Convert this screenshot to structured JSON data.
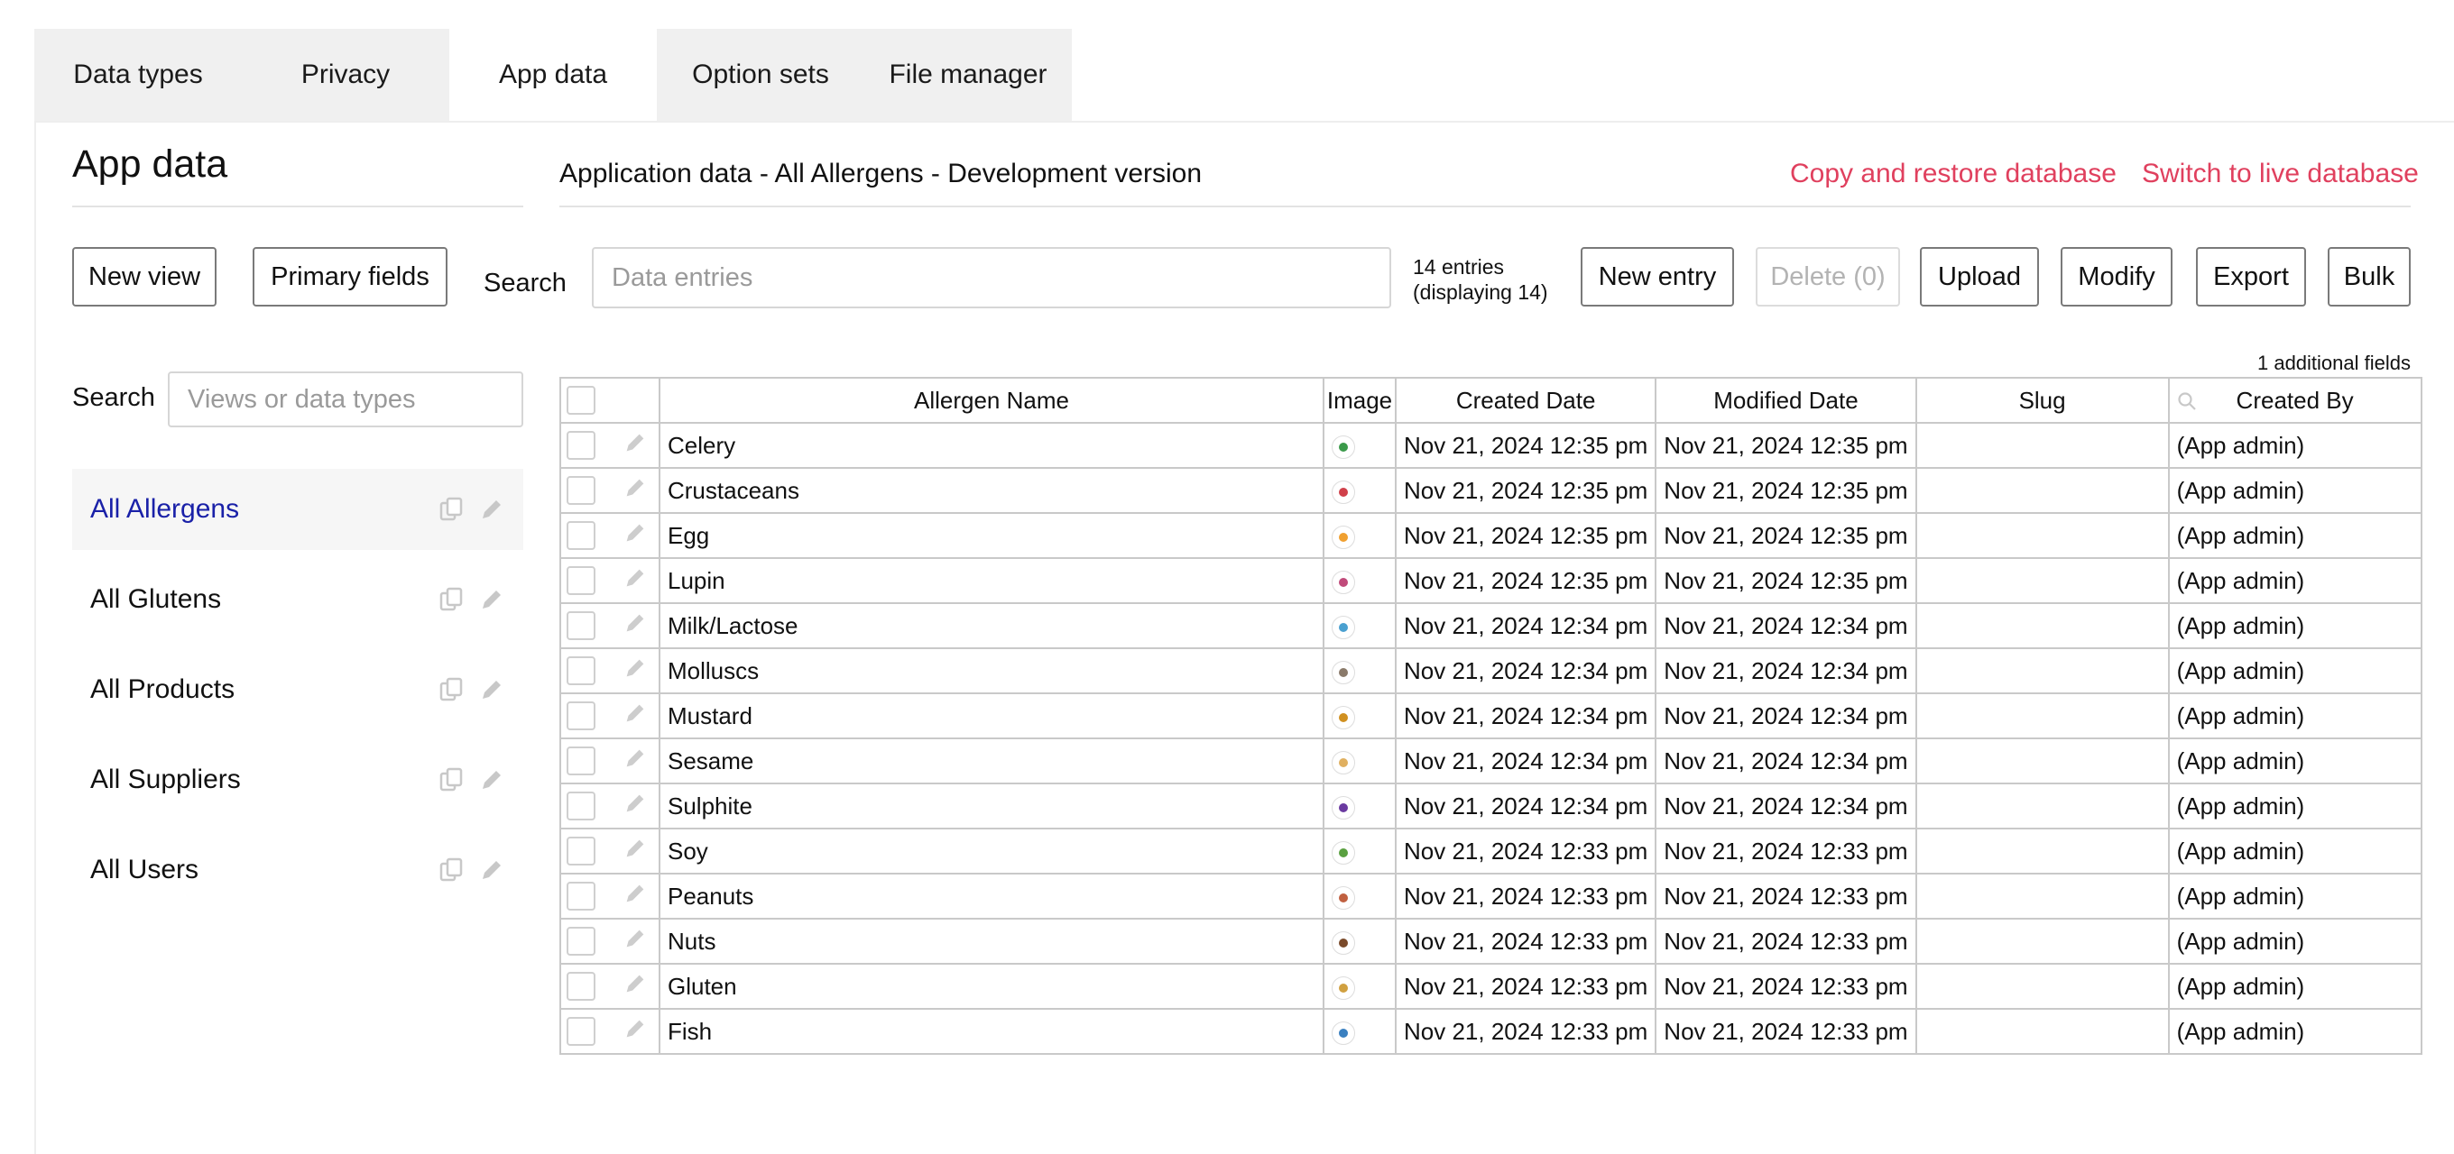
{
  "tabs": [
    {
      "label": "Data types",
      "active": false
    },
    {
      "label": "Privacy",
      "active": false
    },
    {
      "label": "App data",
      "active": true
    },
    {
      "label": "Option sets",
      "active": false
    },
    {
      "label": "File manager",
      "active": false
    }
  ],
  "left": {
    "title": "App data",
    "new_view": "New view",
    "primary_fields": "Primary fields",
    "search_label": "Search",
    "search_placeholder": "Views or data types",
    "views": [
      {
        "label": "All Allergens",
        "active": true
      },
      {
        "label": "All Glutens",
        "active": false
      },
      {
        "label": "All Products",
        "active": false
      },
      {
        "label": "All Suppliers",
        "active": false
      },
      {
        "label": "All Users",
        "active": false
      }
    ]
  },
  "main": {
    "title": "Application data - All Allergens - Development version",
    "copy_restore": "Copy and restore database",
    "switch_live": "Switch to live database",
    "search_label": "Search",
    "search_placeholder": "Data entries",
    "entries_line1": "14 entries",
    "entries_line2": "(displaying 14)",
    "buttons": {
      "new_entry": "New entry",
      "delete": "Delete (0)",
      "upload": "Upload",
      "modify": "Modify",
      "export": "Export",
      "bulk": "Bulk"
    },
    "additional_fields": "1 additional fields",
    "columns": [
      "Allergen Name",
      "Image",
      "Created Date",
      "Modified Date",
      "Slug",
      "Created By"
    ],
    "rows": [
      {
        "name": "Celery",
        "color": "#3b9a4a",
        "created": "Nov 21, 2024 12:35 pm",
        "modified": "Nov 21, 2024 12:35 pm",
        "slug": "",
        "by": "(App admin)"
      },
      {
        "name": "Crustaceans",
        "color": "#d0404a",
        "created": "Nov 21, 2024 12:35 pm",
        "modified": "Nov 21, 2024 12:35 pm",
        "slug": "",
        "by": "(App admin)"
      },
      {
        "name": "Egg",
        "color": "#f0a030",
        "created": "Nov 21, 2024 12:35 pm",
        "modified": "Nov 21, 2024 12:35 pm",
        "slug": "",
        "by": "(App admin)"
      },
      {
        "name": "Lupin",
        "color": "#c04a7a",
        "created": "Nov 21, 2024 12:35 pm",
        "modified": "Nov 21, 2024 12:35 pm",
        "slug": "",
        "by": "(App admin)"
      },
      {
        "name": "Milk/Lactose",
        "color": "#4aa0d0",
        "created": "Nov 21, 2024 12:34 pm",
        "modified": "Nov 21, 2024 12:34 pm",
        "slug": "",
        "by": "(App admin)"
      },
      {
        "name": "Molluscs",
        "color": "#8a7a6a",
        "created": "Nov 21, 2024 12:34 pm",
        "modified": "Nov 21, 2024 12:34 pm",
        "slug": "",
        "by": "(App admin)"
      },
      {
        "name": "Mustard",
        "color": "#d09020",
        "created": "Nov 21, 2024 12:34 pm",
        "modified": "Nov 21, 2024 12:34 pm",
        "slug": "",
        "by": "(App admin)"
      },
      {
        "name": "Sesame",
        "color": "#e0b060",
        "created": "Nov 21, 2024 12:34 pm",
        "modified": "Nov 21, 2024 12:34 pm",
        "slug": "",
        "by": "(App admin)"
      },
      {
        "name": "Sulphite",
        "color": "#6a3aa0",
        "created": "Nov 21, 2024 12:34 pm",
        "modified": "Nov 21, 2024 12:34 pm",
        "slug": "",
        "by": "(App admin)"
      },
      {
        "name": "Soy",
        "color": "#5aa040",
        "created": "Nov 21, 2024 12:33 pm",
        "modified": "Nov 21, 2024 12:33 pm",
        "slug": "",
        "by": "(App admin)"
      },
      {
        "name": "Peanuts",
        "color": "#c06040",
        "created": "Nov 21, 2024 12:33 pm",
        "modified": "Nov 21, 2024 12:33 pm",
        "slug": "",
        "by": "(App admin)"
      },
      {
        "name": "Nuts",
        "color": "#7a4a2a",
        "created": "Nov 21, 2024 12:33 pm",
        "modified": "Nov 21, 2024 12:33 pm",
        "slug": "",
        "by": "(App admin)"
      },
      {
        "name": "Gluten",
        "color": "#d0a040",
        "created": "Nov 21, 2024 12:33 pm",
        "modified": "Nov 21, 2024 12:33 pm",
        "slug": "",
        "by": "(App admin)"
      },
      {
        "name": "Fish",
        "color": "#3a80c0",
        "created": "Nov 21, 2024 12:33 pm",
        "modified": "Nov 21, 2024 12:33 pm",
        "slug": "",
        "by": "(App admin)"
      }
    ]
  },
  "colors": {
    "accent_link": "#e0405e",
    "active_view": "#1a21a8"
  }
}
